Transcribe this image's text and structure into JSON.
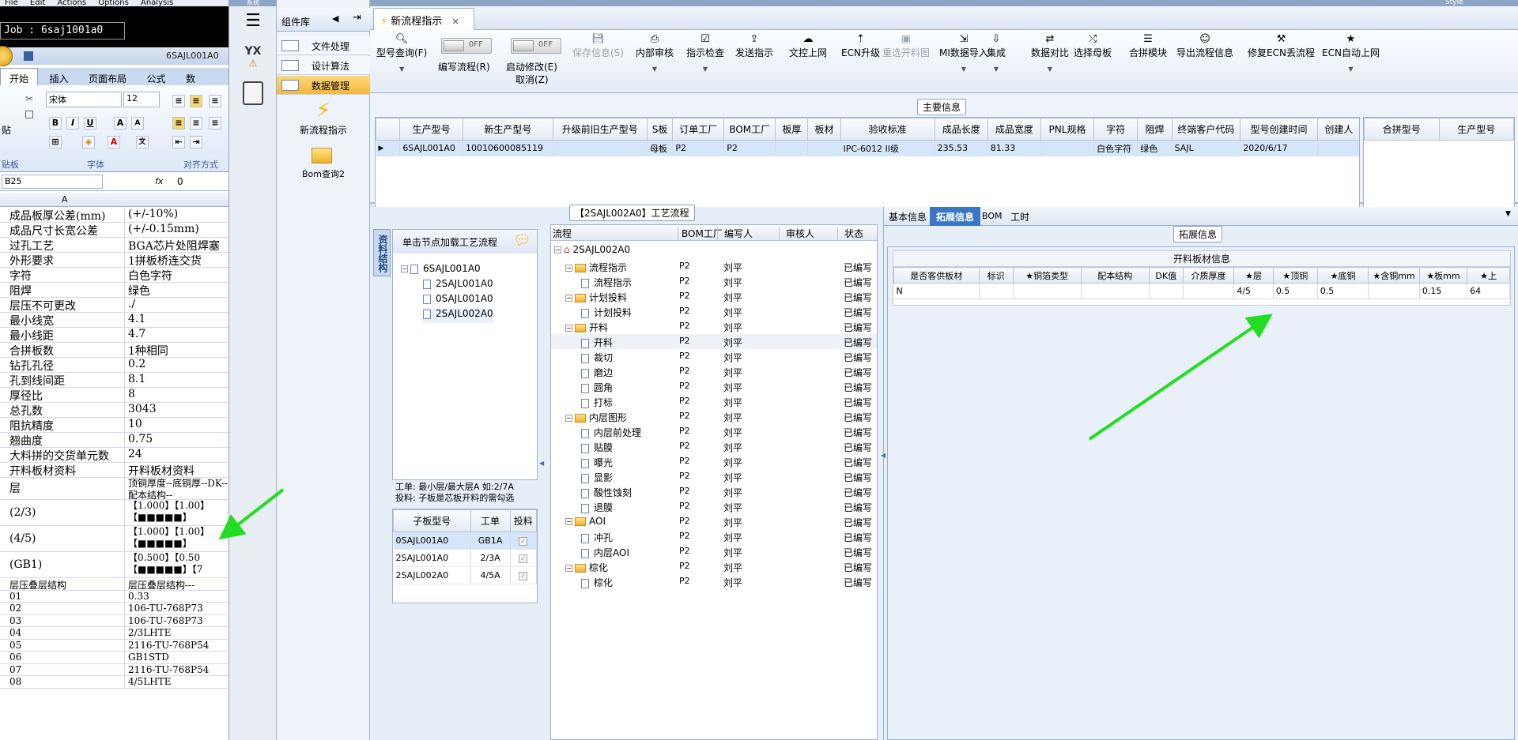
{
  "excel": {
    "menu": [
      "File",
      "Edit",
      "Actions",
      "Options",
      "Analysis"
    ],
    "job_label": "Job : 6saj1001a0",
    "window_title": "6SAJL001A0",
    "tabs": [
      "开始",
      "插入",
      "页面布局",
      "公式",
      "数"
    ],
    "font_name": "宋体",
    "font_size": "12",
    "groups": {
      "clipboard": "贴板",
      "font": "字体",
      "alignment": "对齐方式"
    },
    "paste_label": "贴",
    "name_box": "B25",
    "fx": "fx",
    "formula_value": "0",
    "col_a": "A",
    "rows": [
      {
        "a": "成品板厚公差(mm)",
        "b": "(+/-10%)"
      },
      {
        "a": "成品尺寸长宽公差",
        "b": "(+/-0.15mm)"
      },
      {
        "a": "过孔工艺",
        "b": "BGA芯片处阻焊塞"
      },
      {
        "a": "外形要求",
        "b": "1拼板桥连交货"
      },
      {
        "a": "字符",
        "b": "白色字符"
      },
      {
        "a": "阻焊",
        "b": "绿色"
      },
      {
        "a": "层压不可更改",
        "b": "./"
      },
      {
        "a": "最小线宽",
        "b": "4.1"
      },
      {
        "a": "最小线距",
        "b": "4.7"
      },
      {
        "a": "合拼板数",
        "b": "1种相同"
      },
      {
        "a": "钻孔孔径",
        "b": "0.2"
      },
      {
        "a": "孔到线间距",
        "b": "8.1"
      },
      {
        "a": "厚径比",
        "b": "8"
      },
      {
        "a": "总孔数",
        "b": "3043"
      },
      {
        "a": "阻抗精度",
        "b": "10"
      },
      {
        "a": "翘曲度",
        "b": "0.75"
      },
      {
        "a": "大料拼的交货单元数",
        "b": "24"
      },
      {
        "a": "开料板材资料",
        "b": "开料板材资料"
      }
    ],
    "tall_rows": [
      {
        "a": "层",
        "b": "顶铜厚度--底铜厚--DK--配本结构--"
      },
      {
        "a": "(2/3)",
        "b": "【1.000】【1.00】【■■■■■】"
      },
      {
        "a": "(4/5)",
        "b": "【1.000】【1.00】【■■■■■】"
      },
      {
        "a": "(GB1)",
        "b": "【0.500】【0.50【■■■■■】【7"
      }
    ],
    "rows2": [
      {
        "a": "层压叠层结构",
        "b": "层压叠层结构---"
      },
      {
        "a": "01",
        "b": "0.33"
      },
      {
        "a": "02",
        "b": "106-TU-768P73"
      },
      {
        "a": "03",
        "b": "106-TU-768P73"
      },
      {
        "a": "04",
        "b": "2/3LHTE"
      },
      {
        "a": "05",
        "b": "2116-TU-768P54"
      },
      {
        "a": "06",
        "b": "GB1STD"
      },
      {
        "a": "07",
        "b": "2116-TU-768P54"
      },
      {
        "a": "08",
        "b": "4/5LHTE"
      }
    ]
  },
  "left_bar": {
    "top_label": "系统",
    "logo": "YX"
  },
  "component_panel": {
    "title": "组件库",
    "items": [
      "文件处理",
      "设计算法",
      "数据管理"
    ],
    "tools": [
      "新流程指示",
      "Bom查询2"
    ]
  },
  "main": {
    "tab_title": "新流程指示",
    "style_label": "Style",
    "toolbar": {
      "type_query": "型号查询(F)",
      "toggle_off": "OFF",
      "write_flow": "编写流程(R)",
      "start_modify": "启动修改(E)",
      "cancel": "取消(Z)",
      "save_info": "保存信息(S)",
      "buttons": [
        "内部审核",
        "指示检查",
        "发送指示",
        "文控上网",
        "ECN升级",
        "重选开料图",
        "MI数据导入",
        "集成",
        "数据对比",
        "选择母板",
        "合拼模块",
        "导出流程信息",
        "修复ECN丢流程",
        "ECN自动上网"
      ]
    },
    "main_info": {
      "label": "主要信息",
      "headers": [
        "生产型号",
        "新生产型号",
        "升级前旧生产型号",
        "S板",
        "订单工厂",
        "BOM工厂",
        "板厚",
        "板材",
        "验收标准",
        "成品长度",
        "成品宽度",
        "PNL规格",
        "字符",
        "阻焊",
        "终端客户代码",
        "型号创建时间",
        "创建人"
      ],
      "row": [
        "6SAJL001A0",
        "10010600085119",
        "",
        "母板",
        "P2",
        "P2",
        "",
        "",
        "IPC-6012 II级",
        "235.53",
        "81.33",
        "",
        "白色字符",
        "绿色",
        "SAJL",
        "2020/6/17",
        ""
      ],
      "side_headers": [
        "合拼型号",
        "生产型号"
      ]
    },
    "process": {
      "label": "【2SAJL002A0】工艺流程",
      "vtab": "资料结构",
      "hint": "单击节点加载工艺流程",
      "tree": [
        "6SAJL001A0",
        "2SAJL001A0",
        "0SAJL001A0",
        "2SAJL002A0"
      ],
      "note1": "工单: 最小层/最大层A 如:2/7A",
      "note2": "投料: 子板是芯板开料的需勾选",
      "sub_headers": [
        "子板型号",
        "工单",
        "投料"
      ],
      "sub_rows": [
        {
          "model": "0SAJL001A0",
          "order": "GB1A"
        },
        {
          "model": "2SAJL001A0",
          "order": "2/3A"
        },
        {
          "model": "2SAJL002A0",
          "order": "4/5A"
        }
      ],
      "flow_headers": [
        "流程",
        "BOM工厂",
        "编写人",
        "审核人",
        "状态"
      ],
      "flow_root": "2SAJL002A0",
      "flow_rows": [
        {
          "name": "流程指示",
          "lvl": 1,
          "bom": "P2",
          "writer": "刘平",
          "status": "已编写"
        },
        {
          "name": "流程指示",
          "lvl": 2,
          "bom": "P2",
          "writer": "刘平",
          "status": "已编写"
        },
        {
          "name": "计划投料",
          "lvl": 1,
          "bom": "P2",
          "writer": "刘平",
          "status": "已编写"
        },
        {
          "name": "计划投料",
          "lvl": 2,
          "bom": "P2",
          "writer": "刘平",
          "status": "已编写"
        },
        {
          "name": "开料",
          "lvl": 1,
          "bom": "P2",
          "writer": "刘平",
          "status": "已编写"
        },
        {
          "name": "开料",
          "lvl": 2,
          "bom": "P2",
          "writer": "刘平",
          "status": "已编写"
        },
        {
          "name": "裁切",
          "lvl": 2,
          "bom": "P2",
          "writer": "刘平",
          "status": "已编写"
        },
        {
          "name": "磨边",
          "lvl": 2,
          "bom": "P2",
          "writer": "刘平",
          "status": "已编写"
        },
        {
          "name": "圆角",
          "lvl": 2,
          "bom": "P2",
          "writer": "刘平",
          "status": "已编写"
        },
        {
          "name": "打标",
          "lvl": 2,
          "bom": "P2",
          "writer": "刘平",
          "status": "已编写"
        },
        {
          "name": "内层图形",
          "lvl": 1,
          "bom": "P2",
          "writer": "刘平",
          "status": "已编写"
        },
        {
          "name": "内层前处理",
          "lvl": 2,
          "bom": "P2",
          "writer": "刘平",
          "status": "已编写"
        },
        {
          "name": "贴膜",
          "lvl": 2,
          "bom": "P2",
          "writer": "刘平",
          "status": "已编写"
        },
        {
          "name": "曝光",
          "lvl": 2,
          "bom": "P2",
          "writer": "刘平",
          "status": "已编写"
        },
        {
          "name": "显影",
          "lvl": 2,
          "bom": "P2",
          "writer": "刘平",
          "status": "已编写"
        },
        {
          "name": "酸性蚀刻",
          "lvl": 2,
          "bom": "P2",
          "writer": "刘平",
          "status": "已编写"
        },
        {
          "name": "退膜",
          "lvl": 2,
          "bom": "P2",
          "writer": "刘平",
          "status": "已编写"
        },
        {
          "name": "AOI",
          "lvl": 1,
          "bom": "P2",
          "writer": "刘平",
          "status": "已编写"
        },
        {
          "name": "冲孔",
          "lvl": 2,
          "bom": "P2",
          "writer": "刘平",
          "status": "已编写"
        },
        {
          "name": "内层AOI",
          "lvl": 2,
          "bom": "P2",
          "writer": "刘平",
          "status": "已编写"
        },
        {
          "name": "棕化",
          "lvl": 1,
          "bom": "P2",
          "writer": "刘平",
          "status": "已编写"
        },
        {
          "name": "棕化",
          "lvl": 2,
          "bom": "P2",
          "writer": "刘平",
          "status": "已编写"
        }
      ]
    },
    "right": {
      "tabs": [
        "基本信息",
        "拓展信息",
        "BOM",
        "工时"
      ],
      "ext_label": "拓展信息",
      "table_title": "开料板材信息",
      "headers": [
        "是否客供板材",
        "标识",
        "★铜箔类型",
        "配本结构",
        "DK值",
        "介质厚度",
        "★层",
        "★顶铜",
        "★底铜",
        "★含铜mm",
        "★板mm",
        "★上"
      ],
      "row": [
        "N",
        "",
        "",
        "",
        "",
        "",
        "4/5",
        "0.5",
        "0.5",
        "",
        "0.15",
        "64"
      ]
    }
  },
  "colors": {
    "arrow": "#22dd22",
    "selected_tab": "#3b76c4",
    "highlight": "#f5b840"
  }
}
